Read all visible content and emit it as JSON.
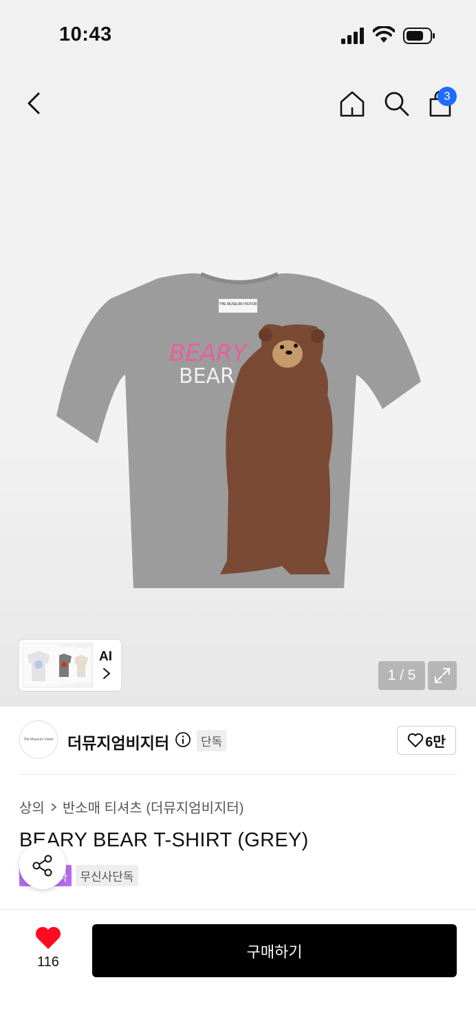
{
  "status_bar": {
    "time": "10:43"
  },
  "header": {
    "back_icon": "chevron-left-icon",
    "home_icon": "home-icon",
    "search_icon": "search-icon",
    "cart_icon": "bag-icon",
    "cart_count": "3",
    "cart_badge_color": "#1e6bff"
  },
  "gallery": {
    "ai_label": "AI",
    "pager": "1 / 5",
    "shirt_print_line1": "BEARY",
    "shirt_print_line2": "BEAR",
    "shirt_neck_label": "THE MUSEUM VISITOR"
  },
  "brand": {
    "logo_text": "The Museum Visitor",
    "name": "더뮤지엄비지터",
    "badge": "단독",
    "likes": "6만"
  },
  "product": {
    "breadcrumb": [
      "상의",
      "반소매 티셔츠 (더뮤지엄비지터)"
    ],
    "title": "BEARY BEAR T-SHIRT (GREY)",
    "tags": [
      "스타",
      "무신사단독"
    ],
    "tag_colors": {
      "purple": "#b66cf0",
      "grey": "#eeeeee"
    }
  },
  "bottom": {
    "heart_count": "116",
    "buy_label": "구매하기",
    "heart_color": "#ff0a1e"
  }
}
